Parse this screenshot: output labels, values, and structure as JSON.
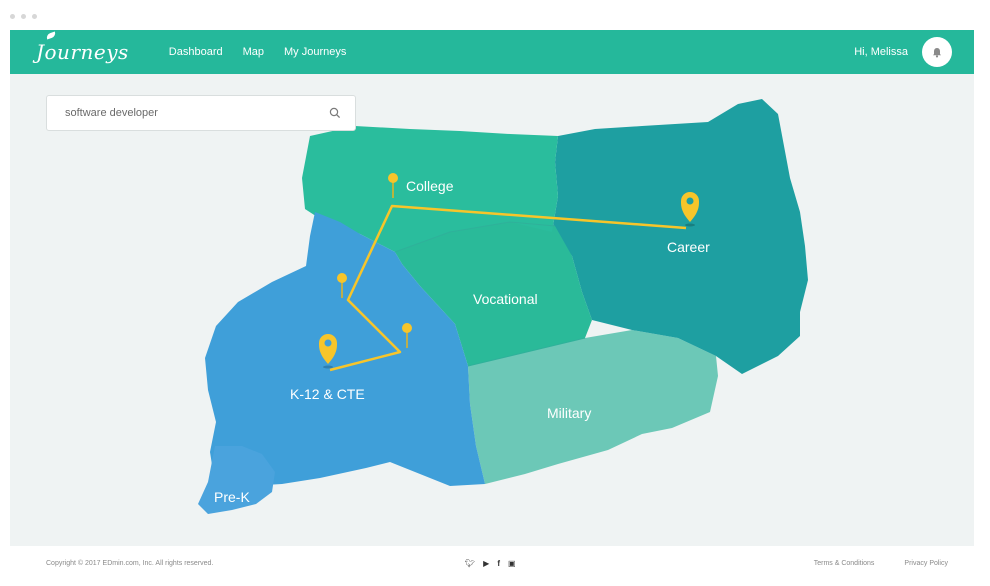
{
  "window": {
    "controls": [
      "close",
      "minimize",
      "maximize"
    ]
  },
  "nav": {
    "logo": "Journeys",
    "links": [
      "Dashboard",
      "Map",
      "My Journeys"
    ],
    "greeting": "Hi, Melissa",
    "bell_icon": "bell-icon"
  },
  "search": {
    "value": "software developer",
    "icon": "search-icon"
  },
  "map": {
    "regions": {
      "college": "College",
      "career": "Career",
      "vocational": "Vocational",
      "k12": "K-12 & CTE",
      "military": "Military",
      "prek": "Pre-K"
    },
    "colors": {
      "college": "#2abd9d",
      "career": "#1e9fa1",
      "vocational": "#2aba99",
      "k12": "#3f9fd9",
      "military": "#6cc8b7",
      "path": "#f7c52a"
    }
  },
  "footer": {
    "copyright": "Copyright © 2017 EDmin.com, Inc. All rights reserved.",
    "social": [
      "twitter-icon",
      "youtube-icon",
      "facebook-icon",
      "instagram-icon"
    ],
    "links": [
      "Terms & Conditions",
      "Privacy Policy"
    ]
  }
}
